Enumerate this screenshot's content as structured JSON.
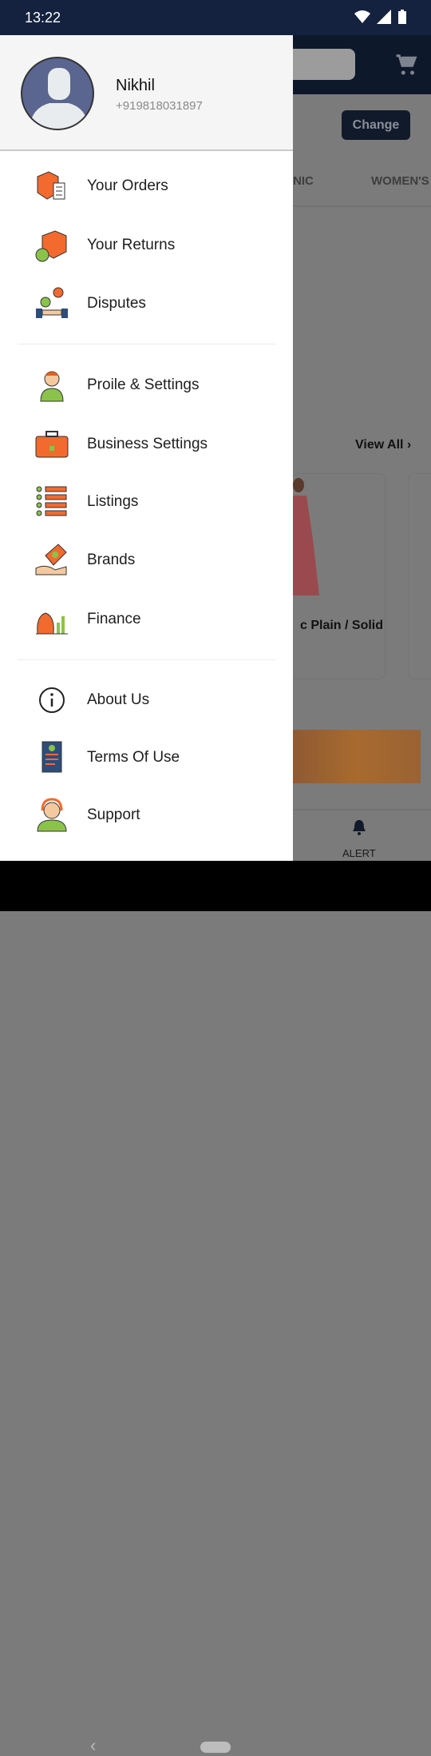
{
  "status": {
    "time": "13:22"
  },
  "background": {
    "change_label": "Change",
    "tabs": [
      "NIC",
      "WOMEN'S"
    ],
    "view_all": "View All",
    "product_title": "c Plain / Solid",
    "alert_label": "ALERT"
  },
  "profile": {
    "name": "Nikhil",
    "phone": "+919818031897"
  },
  "menu": {
    "group1": [
      {
        "label": "Your Orders",
        "icon": "orders-box-icon"
      },
      {
        "label": "Your Returns",
        "icon": "returns-box-icon"
      },
      {
        "label": "Disputes",
        "icon": "disputes-icon"
      }
    ],
    "group2": [
      {
        "label": "Proile & Settings",
        "icon": "profile-icon"
      },
      {
        "label": "Business Settings",
        "icon": "briefcase-icon"
      },
      {
        "label": "Listings",
        "icon": "listings-icon"
      },
      {
        "label": "Brands",
        "icon": "brands-tag-icon"
      },
      {
        "label": "Finance",
        "icon": "finance-icon"
      }
    ],
    "group3": [
      {
        "label": "About Us",
        "icon": "info-icon"
      },
      {
        "label": "Terms Of Use",
        "icon": "terms-document-icon"
      },
      {
        "label": "Support",
        "icon": "support-agent-icon"
      }
    ]
  },
  "colors": {
    "navy": "#14223f",
    "accent": "#f26a2e"
  }
}
